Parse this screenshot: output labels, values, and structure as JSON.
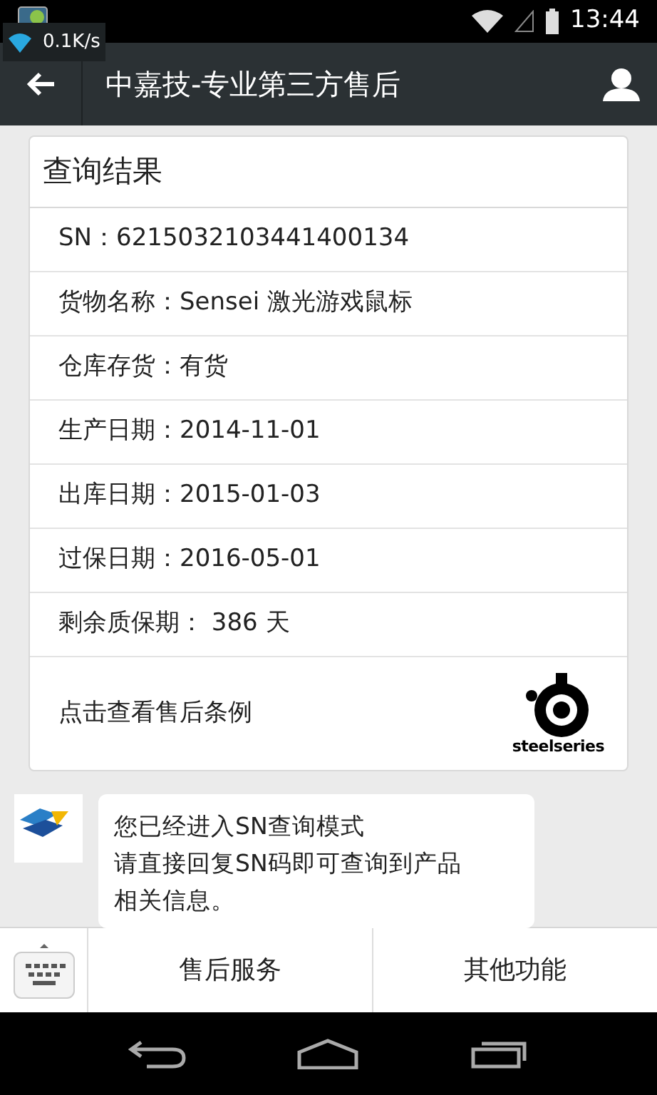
{
  "status_bar": {
    "time": "13:44"
  },
  "speed_widget": {
    "text": "0.1K/s"
  },
  "app_bar": {
    "title": "中嘉技-专业第三方售后"
  },
  "result_card": {
    "title": "查询结果",
    "rows": [
      {
        "text": "SN：6215032103441400134"
      },
      {
        "text": "货物名称：Sensei 激光游戏鼠标"
      },
      {
        "text": "仓库存货：有货"
      },
      {
        "text": "生产日期：2014-11-01"
      },
      {
        "text": "出库日期：2015-01-03"
      },
      {
        "text": "过保日期：2016-05-01"
      },
      {
        "text": "剩余质保期： 386 天"
      }
    ],
    "link": "点击查看售后条例",
    "logo_text": "steelseries"
  },
  "message": {
    "lines": [
      "您已经进入SN查询模式",
      "请直接回复SN码即可查询到产品",
      "相关信息。"
    ]
  },
  "menu": [
    "售后服务",
    "其他功能"
  ]
}
